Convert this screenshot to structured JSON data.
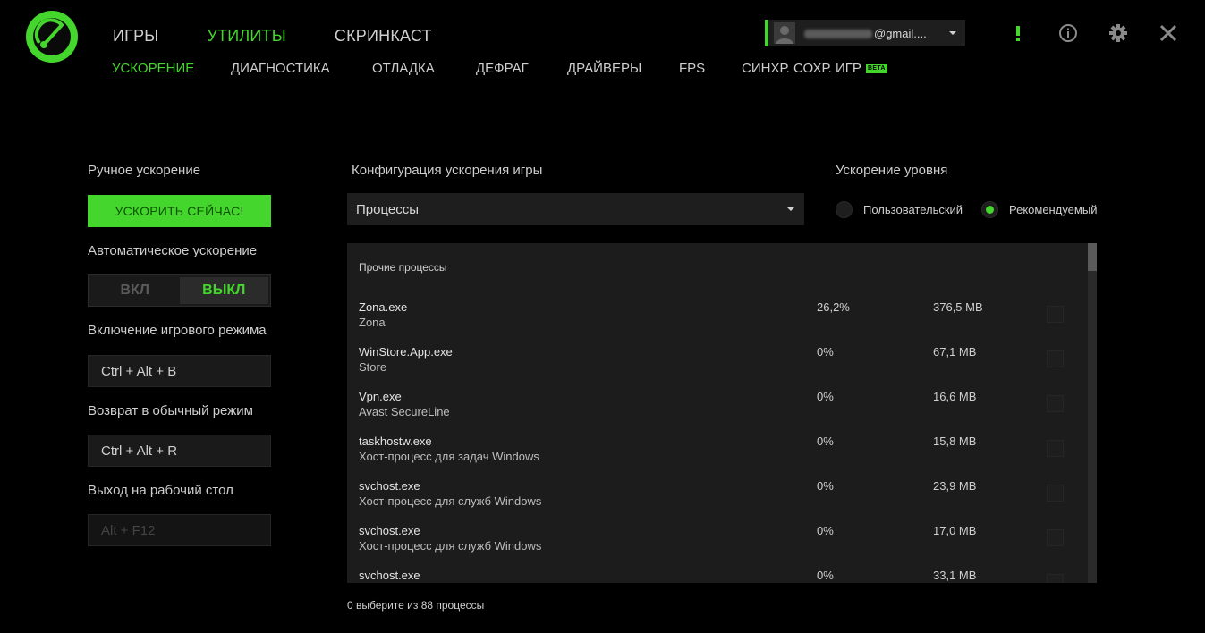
{
  "nav": {
    "main": [
      "ИГРЫ",
      "УТИЛИТЫ",
      "СКРИНКАСТ"
    ],
    "main_active": "УТИЛИТЫ",
    "sub": [
      "УСКОРЕНИЕ",
      "ДИАГНОСТИКА",
      "ОТЛАДКА",
      "ДЕФРАГ",
      "ДРАЙВЕРЫ",
      "FPS",
      "СИНХР. СОХР. ИГР"
    ],
    "sub_active": "УСКОРЕНИЕ",
    "beta_badge": "BETA"
  },
  "account": {
    "email_suffix": "@gmail...."
  },
  "icons": {
    "alert": "exclamation-icon",
    "info": "info-icon",
    "settings": "gear-icon",
    "close": "close-icon"
  },
  "left": {
    "manual_boost_label": "Ручное ускорение",
    "boost_now_button": "УСКОРИТЬ СЕЙЧАС!",
    "auto_boost_label": "Автоматическое ускорение",
    "toggle_on": "ВКЛ",
    "toggle_off": "ВЫКЛ",
    "game_mode_label": "Включение игрового режима",
    "game_mode_hotkey": "Ctrl + Alt + B",
    "normal_mode_label": "Возврат в обычный режим",
    "normal_mode_hotkey": "Ctrl + Alt + R",
    "desktop_label": "Выход на рабочий стол",
    "desktop_hotkey": "Alt + F12"
  },
  "config": {
    "label": "Конфигурация ускорения игры",
    "selected": "Процессы"
  },
  "level": {
    "label": "Ускорение уровня",
    "options": [
      "Пользовательский",
      "Рекомендуемый"
    ],
    "selected": "Рекомендуемый"
  },
  "processes": {
    "header": "Прочие процессы",
    "rows": [
      {
        "name": "Zona.exe",
        "desc": "Zona",
        "cpu": "26,2%",
        "mem": "376,5 MB"
      },
      {
        "name": "WinStore.App.exe",
        "desc": "Store",
        "cpu": "0%",
        "mem": "67,1 MB"
      },
      {
        "name": "Vpn.exe",
        "desc": "Avast SecureLine",
        "cpu": "0%",
        "mem": "16,6 MB"
      },
      {
        "name": "taskhostw.exe",
        "desc": "Хост-процесс для задач Windows",
        "cpu": "0%",
        "mem": "15,8 MB"
      },
      {
        "name": "svchost.exe",
        "desc": "Хост-процесс для служб Windows",
        "cpu": "0%",
        "mem": "23,9 MB"
      },
      {
        "name": "svchost.exe",
        "desc": "Хост-процесс для служб Windows",
        "cpu": "0%",
        "mem": "17,0 MB"
      },
      {
        "name": "svchost.exe",
        "desc": "",
        "cpu": "0%",
        "mem": "33,1 MB"
      }
    ],
    "footer": "0 выберите из 88 процессы"
  },
  "colors": {
    "accent": "#44d62c",
    "background": "#000000",
    "panel": "#1c1c1c"
  }
}
